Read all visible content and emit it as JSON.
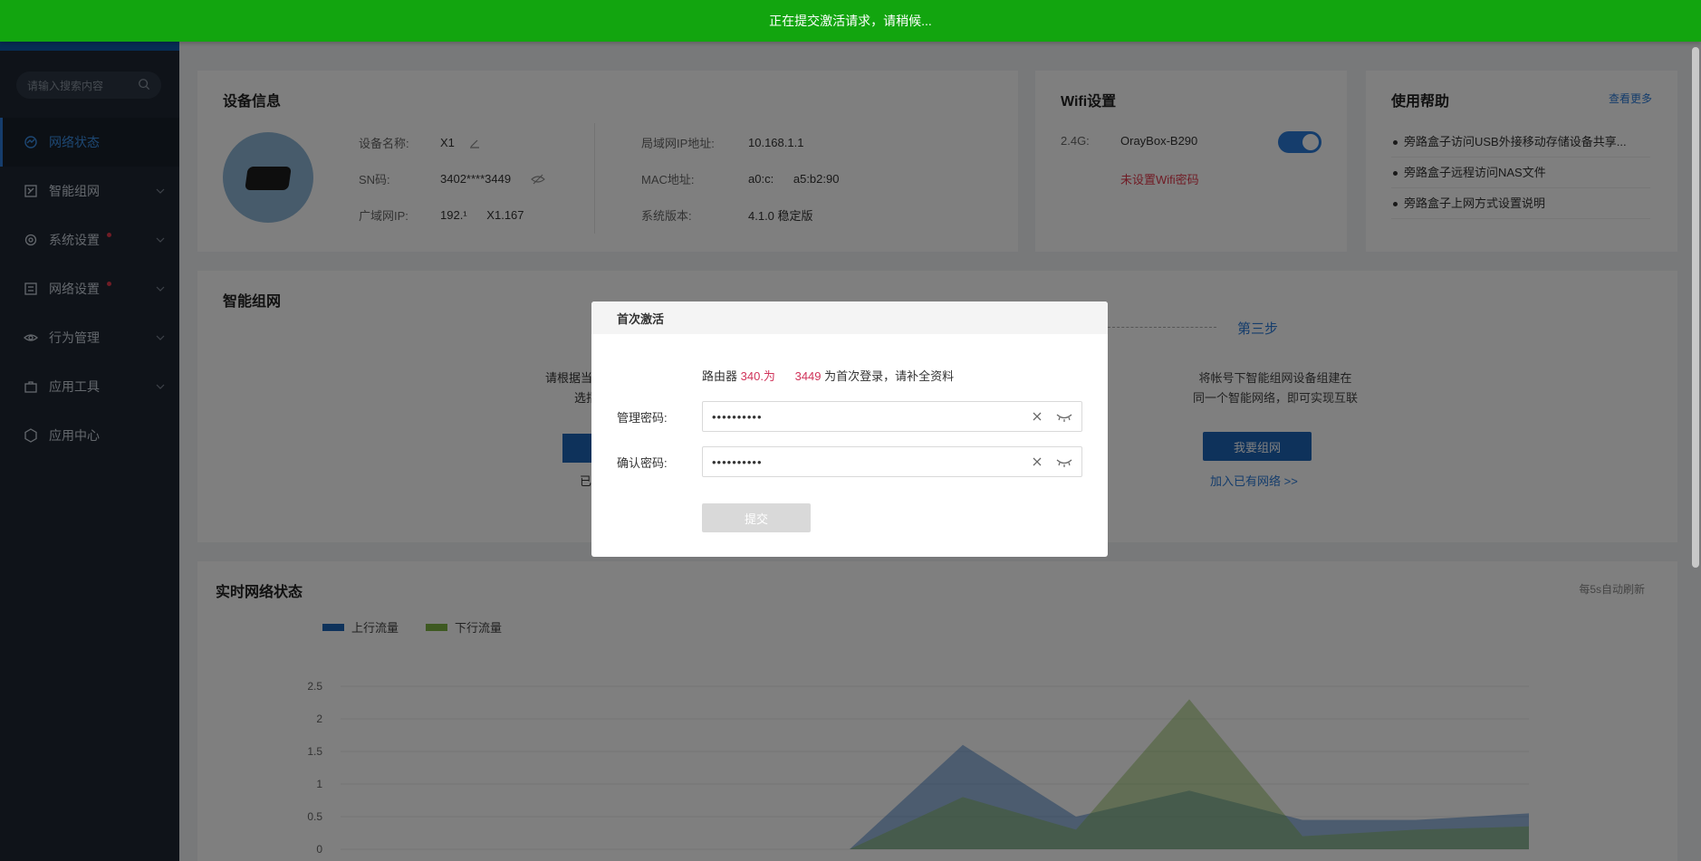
{
  "topbar": {
    "message": "正在提交激活请求，请稍候..."
  },
  "sidebar": {
    "search_placeholder": "请输入搜索内容",
    "items": [
      {
        "label": "网络状态",
        "active": true,
        "icon": "status-icon"
      },
      {
        "label": "智能组网",
        "icon": "network-icon"
      },
      {
        "label": "系统设置",
        "icon": "settings-icon",
        "badge": true
      },
      {
        "label": "网络设置",
        "icon": "web-settings-icon",
        "badge": true
      },
      {
        "label": "行为管理",
        "icon": "behavior-icon"
      },
      {
        "label": "应用工具",
        "icon": "tools-icon"
      },
      {
        "label": "应用中心",
        "icon": "app-center-icon"
      }
    ]
  },
  "device": {
    "title": "设备信息",
    "name_label": "设备名称:",
    "name_value": "X1",
    "sn_label": "SN码:",
    "sn_value": "3402****3449",
    "wan_label": "广域网IP:",
    "wan_value": "192.¹      X1.167",
    "lan_label": "局域网IP地址:",
    "lan_value": "10.168.1.1",
    "mac_label": "MAC地址:",
    "mac_value": "a0:c:      a5:b2:90",
    "ver_label": "系统版本:",
    "ver_value": "4.1.0 稳定版"
  },
  "wifi": {
    "title": "Wifi设置",
    "band": "2.4G:",
    "ssid": "OrayBox-B290",
    "warning": "未设置Wifi密码",
    "warning_color": "#e0384b",
    "enabled": true
  },
  "help": {
    "title": "使用帮助",
    "more": "查看更多",
    "items": [
      "旁路盒子访问USB外接移动存储设备共享...",
      "旁路盒子远程访问NAS文件",
      "旁路盒子上网方式设置说明"
    ]
  },
  "mesh": {
    "title": "智能组网",
    "step3": "第三步",
    "left_text1": "请根据当",
    "left_text2": "选指",
    "left_text3": "已",
    "right_text1": "将帐号下智能组网设备组建在",
    "right_text2": "同一个智能网络，即可实现互联",
    "btn": "我要组网",
    "link": "加入已有网络 >>"
  },
  "realtime": {
    "title": "实时网络状态",
    "refresh": "每5s自动刷新",
    "legend_up": "上行流量",
    "legend_down": "下行流量",
    "up_color": "#1d64b6",
    "down_color": "#7cb342"
  },
  "chart_data": {
    "type": "area",
    "yticks": [
      "2.5",
      "2",
      "1.5",
      "1",
      "0.5",
      "0"
    ],
    "ylim": [
      0,
      2.5
    ],
    "series": [
      {
        "name": "上行流量",
        "values": [
          0,
          0,
          0,
          1.6,
          0.5,
          0.9,
          0.45,
          0.45,
          0.55
        ]
      },
      {
        "name": "下行流量",
        "values": [
          0,
          0,
          0,
          0.8,
          0.3,
          2.3,
          0.2,
          0.3,
          0.35
        ]
      }
    ]
  },
  "modal": {
    "title": "首次激活",
    "msg_prefix": "路由器 ",
    "msg_sn": "340.为      3449",
    "msg_suffix": " 为首次登录，请补全资料",
    "pwd_label": "管理密码:",
    "pwd_value": "••••••••••",
    "confirm_label": "确认密码:",
    "confirm_value": "••••••••••",
    "submit": "提交"
  }
}
